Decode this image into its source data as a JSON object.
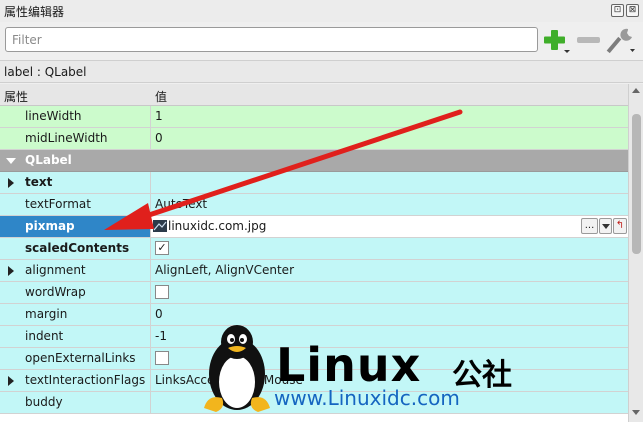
{
  "window": {
    "title": "属性编辑器",
    "float_glyph": "⊡",
    "close_glyph": "⊠"
  },
  "filter": {
    "placeholder": "Filter",
    "value": ""
  },
  "toolbar": {
    "add_icon": "plus-icon",
    "remove_icon": "minus-icon",
    "config_icon": "wrench-icon"
  },
  "object_label": "label : QLabel",
  "columns": {
    "property": "属性",
    "value": "值"
  },
  "rows": [
    {
      "name": "lineWidth",
      "value": "1"
    },
    {
      "name": "midLineWidth",
      "value": "0"
    },
    {
      "name": "QLabel",
      "value": ""
    },
    {
      "name": "text",
      "value": ""
    },
    {
      "name": "textFormat",
      "value": "AutoText"
    },
    {
      "name": "pixmap",
      "value": "linuxidc.com.jpg",
      "browse_label": "..."
    },
    {
      "name": "scaledContents",
      "value": "✓"
    },
    {
      "name": "alignment",
      "value": "AlignLeft, AlignVCenter"
    },
    {
      "name": "wordWrap",
      "value": ""
    },
    {
      "name": "margin",
      "value": "0"
    },
    {
      "name": "indent",
      "value": "-1"
    },
    {
      "name": "openExternalLinks",
      "value": ""
    },
    {
      "name": "textInteractionFlags",
      "value": "LinksAccessibleByMouse"
    },
    {
      "name": "buddy",
      "value": ""
    }
  ],
  "watermark": {
    "brand": "Linux",
    "cn": "公社",
    "url": "www.Linuxidc.com"
  },
  "colors": {
    "green_row": "#ccfbcc",
    "cyan_row": "#c2f7f7",
    "section_row": "#a9a9a9",
    "selected": "#2f86c8",
    "arrow": "#e0201c"
  }
}
